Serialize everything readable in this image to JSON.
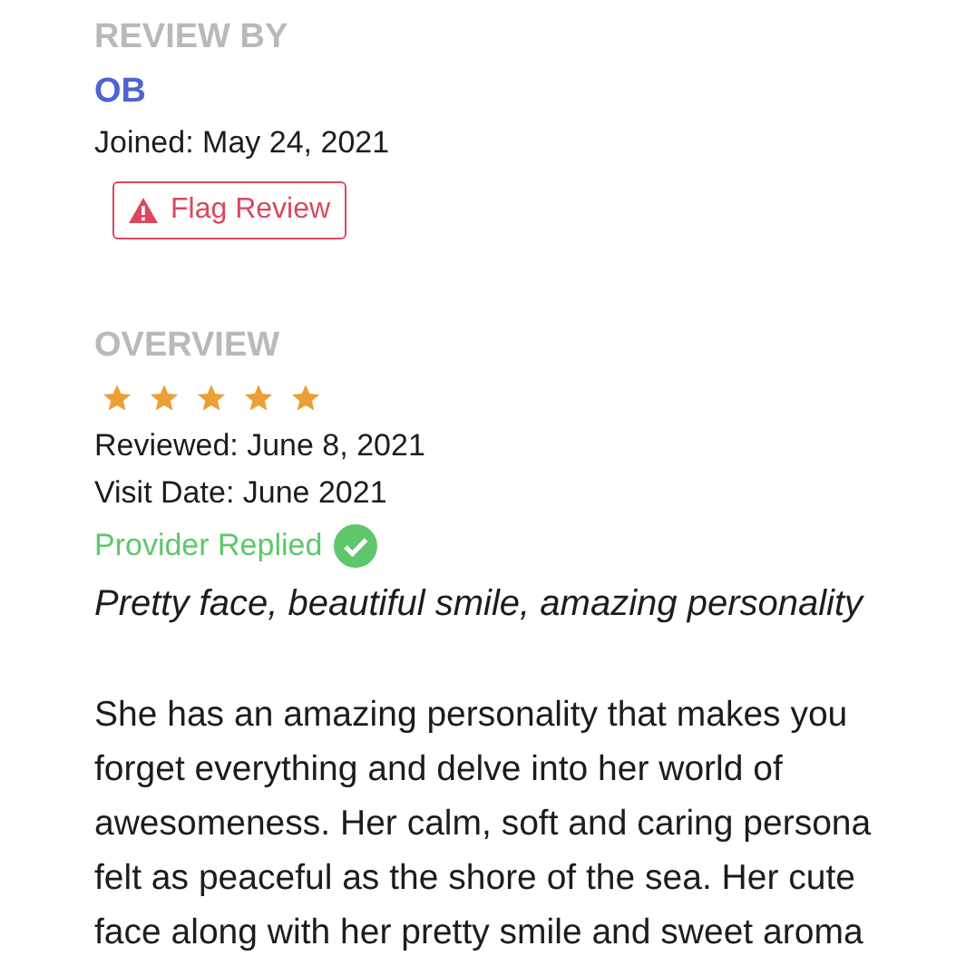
{
  "review_by": {
    "heading": "REVIEW BY",
    "name": "OB",
    "joined": "Joined: May 24, 2021",
    "flag_button": "Flag Review"
  },
  "overview": {
    "heading": "OVERVIEW",
    "stars": 5,
    "reviewed": "Reviewed: June 8, 2021",
    "visit_date": "Visit Date: June 2021",
    "provider_replied": true,
    "provider_replied_label": "Provider Replied",
    "title": "Pretty face, beautiful smile, amazing personality",
    "body": "She has an amazing personality that makes you forget everything and delve into her world of awesomeness. Her calm, soft and caring persona felt as peaceful as the shore of the sea. Her cute face along with her pretty smile and sweet aroma"
  }
}
